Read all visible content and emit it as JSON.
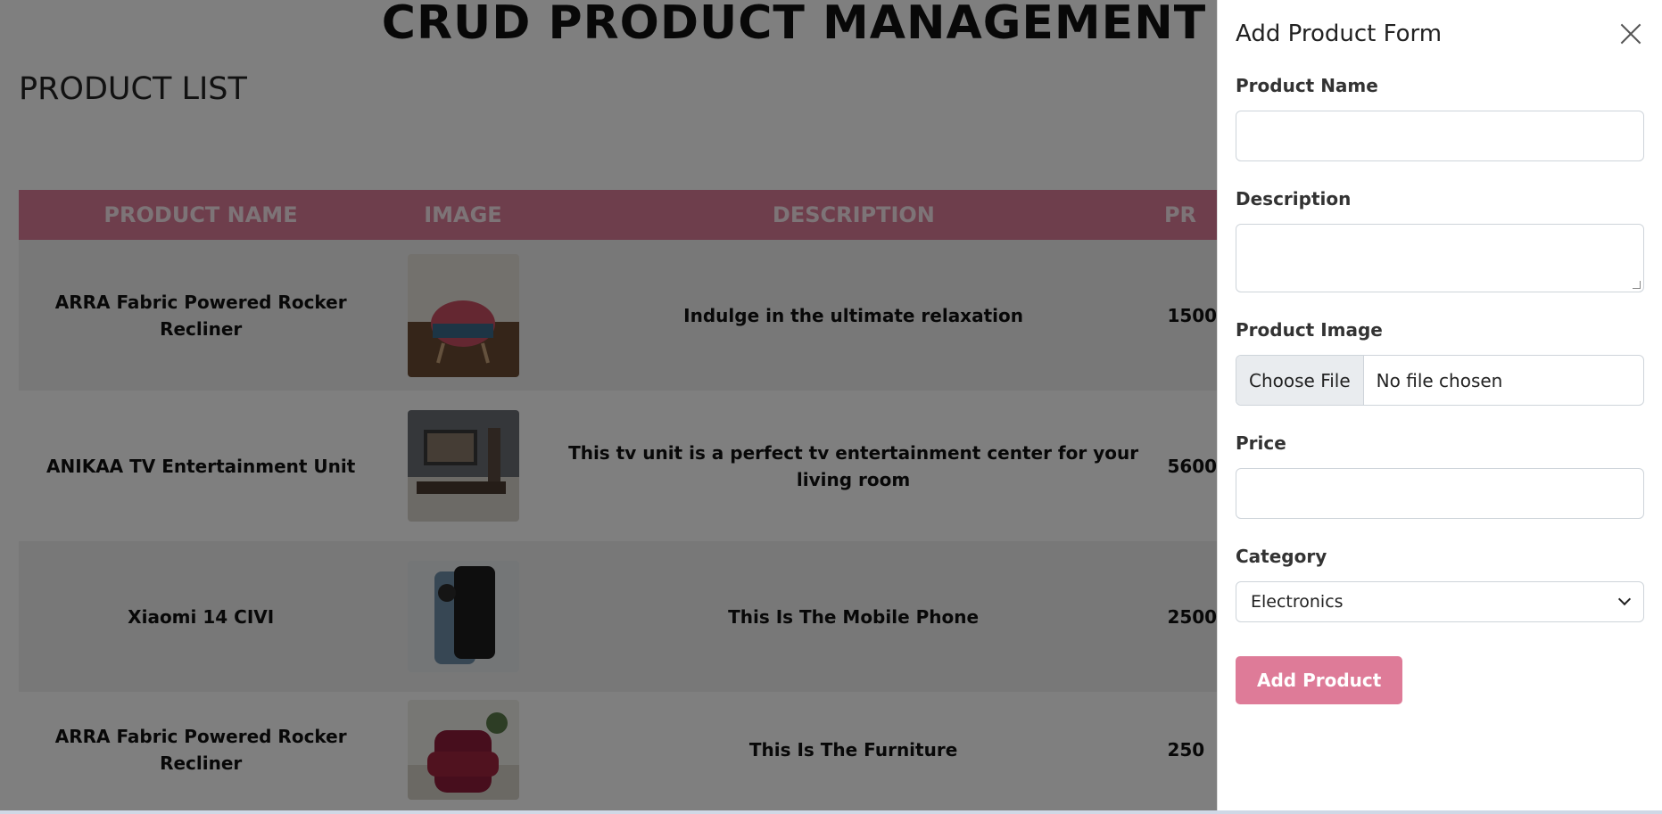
{
  "page": {
    "title": "CRUD PRODUCT MANAGEMENT",
    "list_title": "PRODUCT LIST"
  },
  "table": {
    "headers": [
      "PRODUCT NAME",
      "IMAGE",
      "DESCRIPTION",
      "PR"
    ],
    "rows": [
      {
        "name": "ARRA Fabric Powered Rocker Recliner",
        "description": "Indulge in the ultimate relaxation",
        "price": "1500"
      },
      {
        "name": "ANIKAA TV Entertainment Unit",
        "description": "This tv unit is a perfect tv entertainment center for your living room",
        "price": "5600"
      },
      {
        "name": "Xiaomi 14 CIVI",
        "description": "This Is The Mobile Phone",
        "price": "2500"
      },
      {
        "name": "ARRA Fabric Powered Rocker Recliner",
        "description": "This Is The Furniture",
        "price": "250"
      }
    ]
  },
  "drawer": {
    "title": "Add Product Form",
    "close_icon": "close-icon",
    "fields": {
      "name_label": "Product Name",
      "name_value": "",
      "description_label": "Description",
      "description_value": "",
      "image_label": "Product Image",
      "file_button": "Choose File",
      "file_status": "No file chosen",
      "price_label": "Price",
      "price_value": "",
      "category_label": "Category",
      "category_value": "Electronics"
    },
    "submit_label": "Add Product"
  },
  "colors": {
    "accent": "#de7b98",
    "header_bg": "#dc7d98",
    "overlay": "rgba(0,0,0,0.5)"
  }
}
